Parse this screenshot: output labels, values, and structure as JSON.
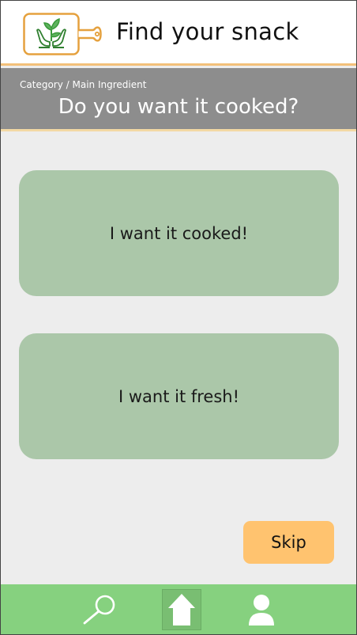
{
  "header": {
    "app_title": "Find your snack",
    "logo_icon": "plant-hands-cutting-board-icon"
  },
  "question": {
    "breadcrumb": "Category / Main Ingredient",
    "title": "Do you want it cooked?"
  },
  "options": [
    {
      "label": "I want it cooked!"
    },
    {
      "label": "I want it fresh!"
    }
  ],
  "skip_label": "Skip",
  "bottom_nav": {
    "items": [
      {
        "icon": "search-icon",
        "active": false
      },
      {
        "icon": "home-icon",
        "active": true
      },
      {
        "icon": "profile-icon",
        "active": false
      }
    ]
  },
  "colors": {
    "header_accent": "#f3c07a",
    "question_bar": "#8d8d8d",
    "option_background": "#abc7a9",
    "skip_background": "#ffc36f",
    "nav_background": "#86d17f",
    "logo_stroke": "#e5a13e",
    "logo_plant": "#3a9a3a"
  }
}
